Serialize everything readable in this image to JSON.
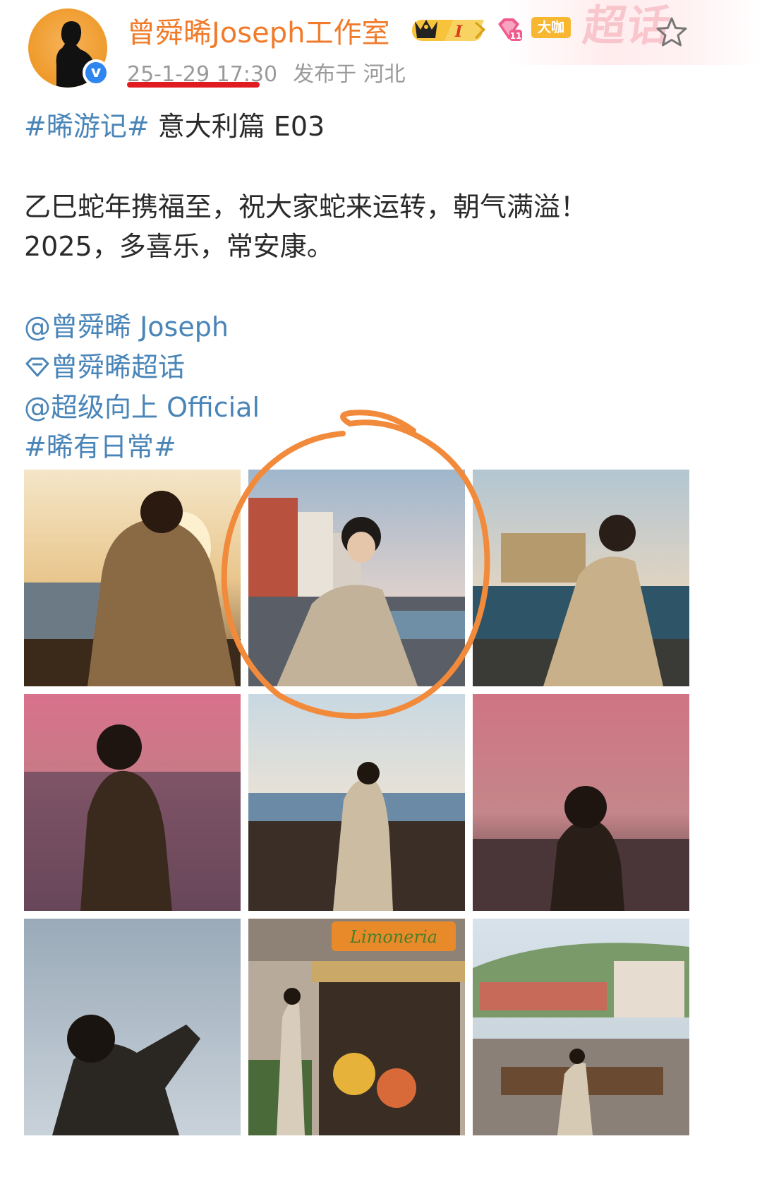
{
  "post": {
    "username": "曾舜晞Joseph工作室",
    "date": "25-1-29 17:30",
    "posted_from": "发布于 河北",
    "badges": {
      "level": "I",
      "daka": "大咖"
    },
    "chaohua_watermark": "超话",
    "colors": {
      "username": "#f07b2a",
      "link": "#4a85b8",
      "underline": "#e11b22",
      "circle": "#f28a3c"
    }
  },
  "content": {
    "hashtag1": "#晞游记#",
    "title_rest": " 意大利篇 E03",
    "line1": "乙巳蛇年携福至，祝大家蛇来运转，朝气满溢！",
    "line2": "2025，多喜乐，常安康。",
    "mention1": "@曾舜晞 Joseph",
    "supertopic": "曾舜晞超话",
    "mention2": "@超级向上 Official",
    "hashtag2": "#晞有日常#"
  },
  "icons": [
    "verified-icon",
    "crown-level-icon",
    "diamond-icon",
    "star-icon",
    "supertopic-diamond-icon"
  ],
  "photos": [
    {
      "id": "photo-1",
      "scene": "sunset-coast-seated"
    },
    {
      "id": "photo-2",
      "scene": "seafront-promenade-leaning"
    },
    {
      "id": "photo-3",
      "scene": "castle-sea-seated"
    },
    {
      "id": "photo-4",
      "scene": "pink-dusk-silhouette"
    },
    {
      "id": "photo-5",
      "scene": "sea-wall-standing"
    },
    {
      "id": "photo-6",
      "scene": "pink-sunset-silhouette"
    },
    {
      "id": "photo-7",
      "scene": "cloudy-sky-reaching"
    },
    {
      "id": "photo-8",
      "scene": "limoneria-shop"
    },
    {
      "id": "photo-9",
      "scene": "hillside-town-bench"
    }
  ],
  "shop_sign": "Limoneria"
}
